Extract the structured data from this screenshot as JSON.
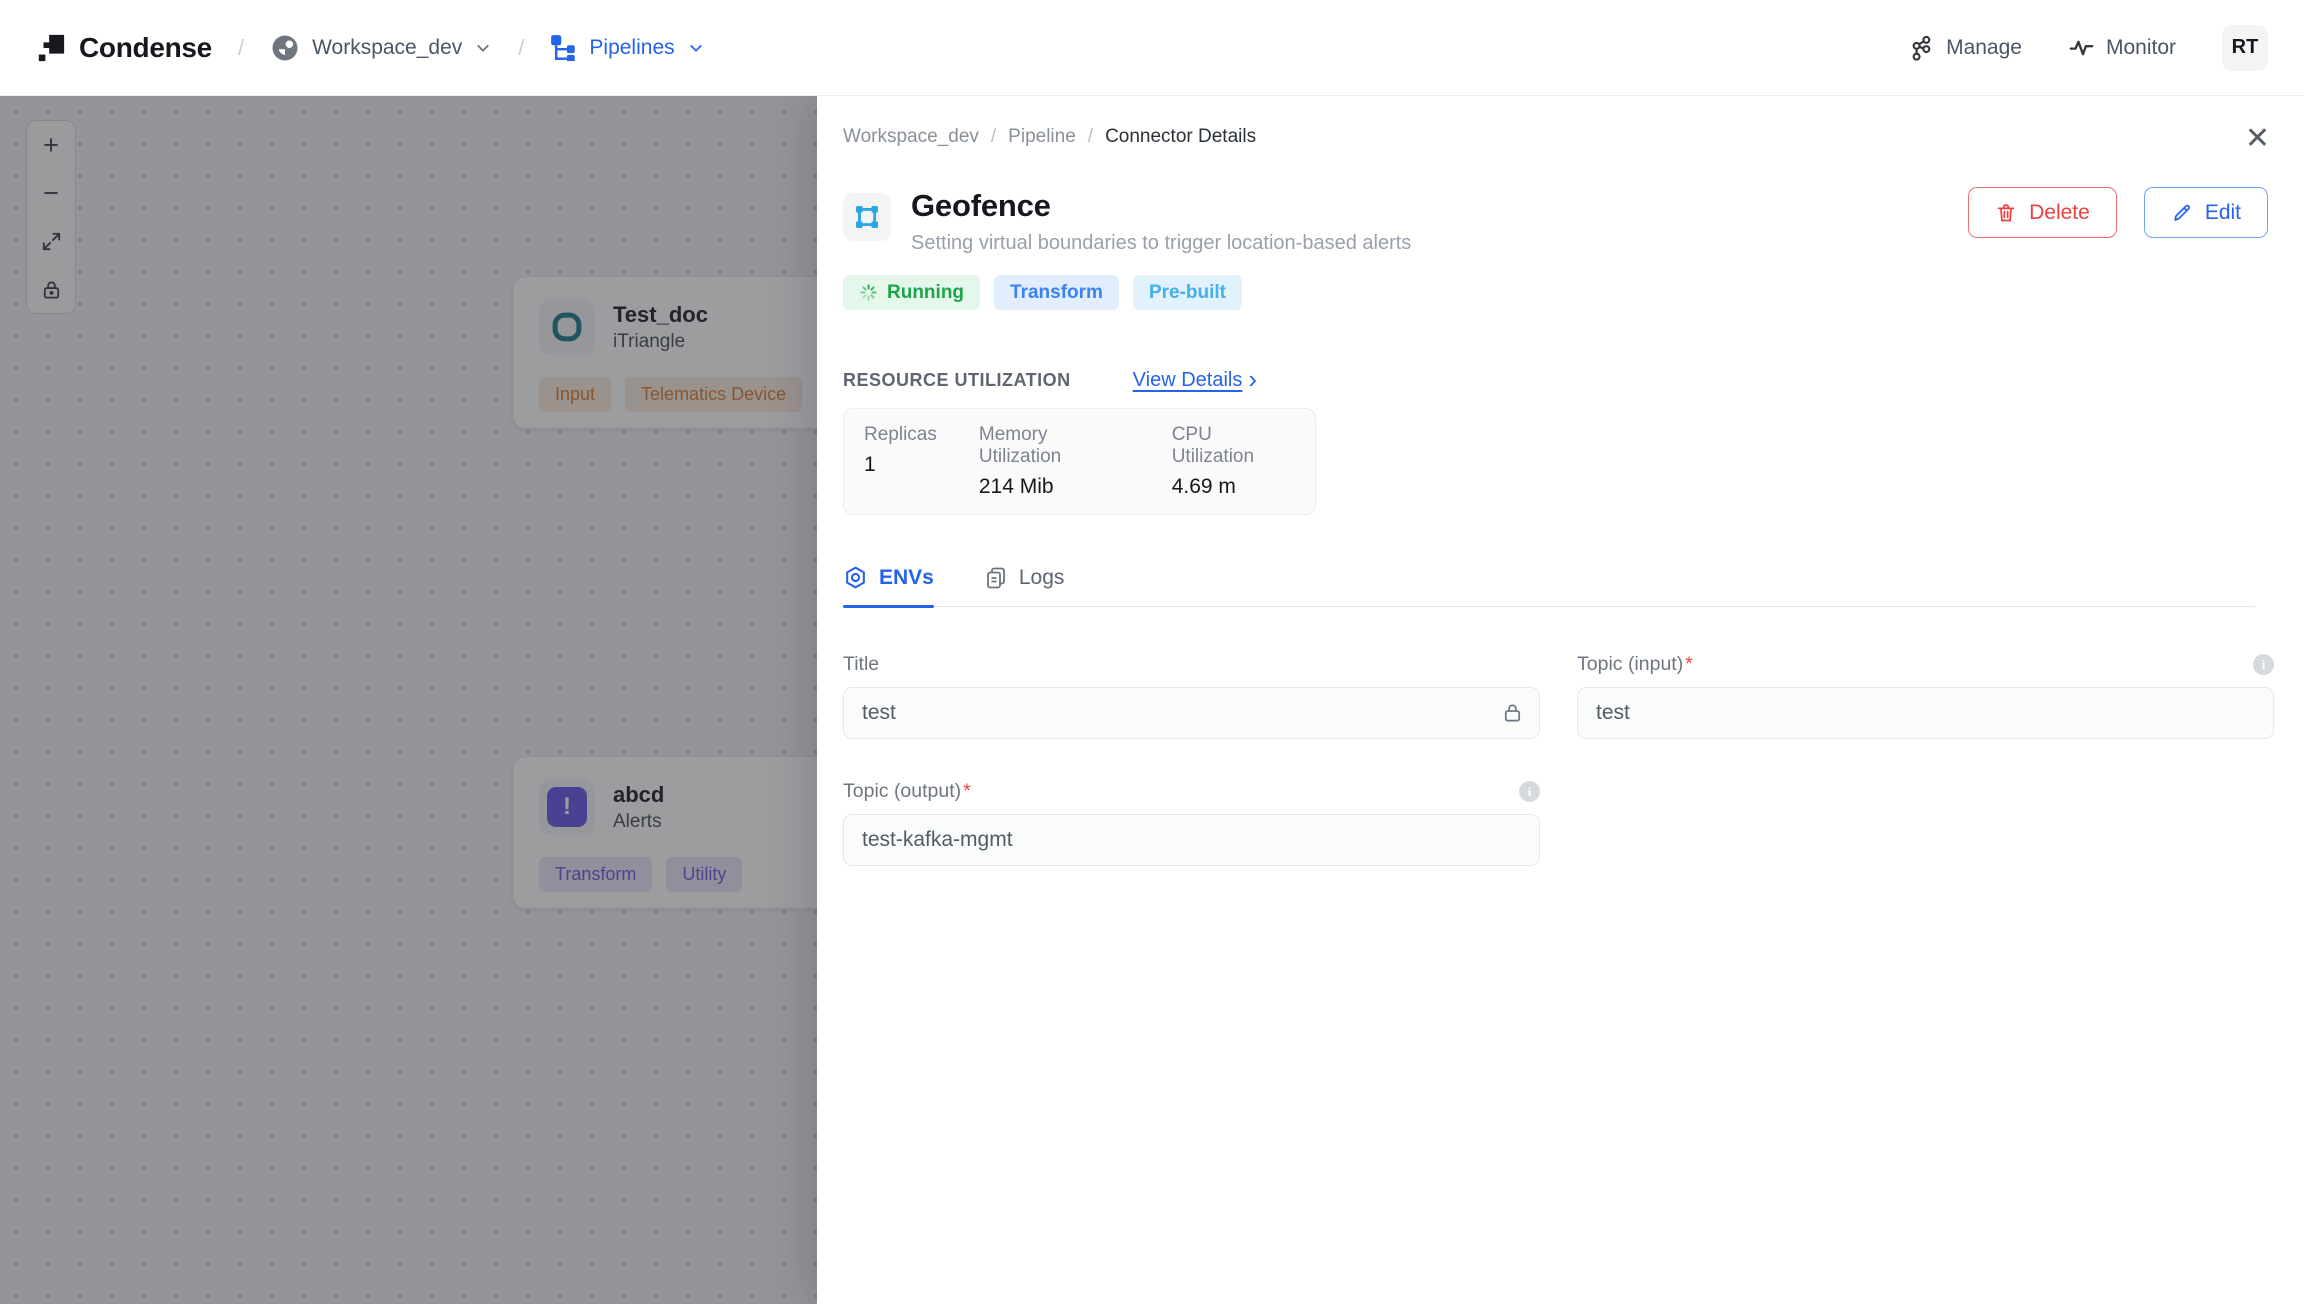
{
  "navbar": {
    "brand": "Condense",
    "sep": "/",
    "workspace_label": "Workspace_dev",
    "pipelines_label": "Pipelines",
    "manage_label": "Manage",
    "monitor_label": "Monitor",
    "avatar_initials": "RT"
  },
  "canvas": {
    "nodes": [
      {
        "title": "Test_doc",
        "subtitle": "iTriangle",
        "tags": [
          "Input",
          "Telematics Device"
        ]
      },
      {
        "title": "abcd",
        "subtitle": "Alerts",
        "tags": [
          "Transform",
          "Utility"
        ],
        "icon_glyph": "!"
      }
    ]
  },
  "panel": {
    "breadcrumb": [
      "Workspace_dev",
      "Pipeline",
      "Connector Details"
    ],
    "breadcrumb_sep": "/",
    "title": "Geofence",
    "description": "Setting virtual boundaries to trigger location-based alerts",
    "actions": {
      "delete_label": "Delete",
      "edit_label": "Edit"
    },
    "badges": [
      {
        "label": "Running",
        "fg": "#1fa34a",
        "bg": "#e5f7eb"
      },
      {
        "label": "Transform",
        "fg": "#3b82f6",
        "bg": "#e2eefd"
      },
      {
        "label": "Pre-built",
        "fg": "#45b0e6",
        "bg": "#e2f2fd"
      }
    ],
    "resource": {
      "heading": "RESOURCE UTILIZATION",
      "view_details_label": "View Details",
      "stats": [
        {
          "label": "Replicas",
          "value": "1"
        },
        {
          "label": "Memory Utilization",
          "value": "214 Mib"
        },
        {
          "label": "CPU Utilization",
          "value": "4.69 m"
        }
      ]
    },
    "tabs": [
      {
        "label": "ENVs",
        "active": true
      },
      {
        "label": "Logs",
        "active": false
      }
    ],
    "form": {
      "required_mark": "*",
      "fields": [
        {
          "label": "Title",
          "value": "test",
          "required": false,
          "locked": true
        },
        {
          "label": "Topic (input)",
          "value": "test",
          "required": true,
          "info": true
        },
        {
          "label": "Topic (output)",
          "value": "test-kafka-mgmt",
          "required": true,
          "info": true
        }
      ]
    }
  },
  "icons": {
    "close_glyph": "✕",
    "chevron_right_glyph": "›",
    "plus_glyph": "+",
    "minus_glyph": "−"
  },
  "colors": {
    "primary_blue": "#2563eb",
    "running_green": "#1fa34a",
    "delete_red": "#ef4040",
    "geofence_blue": "#2aa6e4",
    "node1_teal": "#23808f",
    "node2_purple": "#6c5ce7",
    "tag_orange": "#d9803c"
  }
}
